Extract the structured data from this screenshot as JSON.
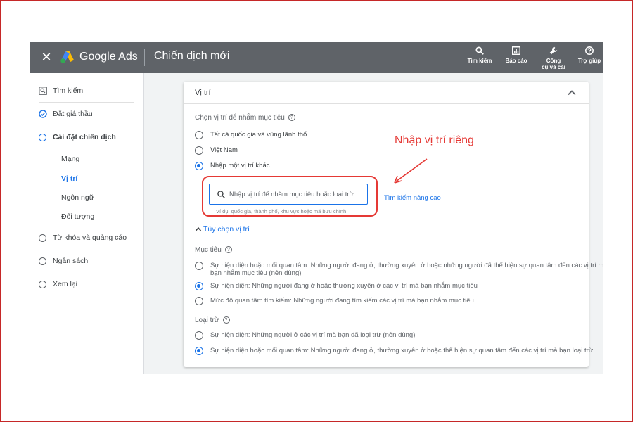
{
  "topbar": {
    "close_icon": "close-icon",
    "brand": "Google Ads",
    "page_title": "Chiến dịch mới",
    "tools": [
      {
        "label": "Tìm kiếm",
        "icon": "search-icon"
      },
      {
        "label": "Báo cáo",
        "icon": "report-icon"
      },
      {
        "label_line1": "Công",
        "label_line2": "cụ và cài",
        "icon": "wrench-icon"
      },
      {
        "label": "Trợ giúp",
        "icon": "help-icon"
      }
    ]
  },
  "sidebar": {
    "search": "Tìm kiếm",
    "bidding": "Đặt giá thầu",
    "campaign_settings": "Cài đặt chiến dịch",
    "sub": [
      "Mạng",
      "Vị trí",
      "Ngôn ngữ",
      "Đối tượng"
    ],
    "keywords_ads": "Từ khóa và quảng cáo",
    "budget": "Ngân sách",
    "review": "Xem lại"
  },
  "card": {
    "title": "Vị trí",
    "choose_label": "Chọn vị trí để nhắm mục tiêu",
    "options": [
      "Tất cả quốc gia và vùng lãnh thổ",
      "Việt Nam",
      "Nhập một vị trí khác"
    ],
    "selected_option": 2,
    "search_placeholder": "Nhập vị trí để nhắm mục tiêu hoặc loại trừ",
    "search_hint": "Ví dụ: quốc gia, thành phố, khu vực hoặc mã bưu chính",
    "advanced_link": "Tìm kiếm nâng cao",
    "options_toggle": "Tùy chọn vị trí",
    "target_label": "Mục tiêu",
    "target_options": [
      {
        "line1": "Sự hiện diện hoặc mối quan tâm: Những người đang ở, thường xuyên ở hoặc những người đã thể hiện sự quan tâm đến các vị trí mà",
        "line2": "bạn nhắm mục tiêu (nên dùng)"
      },
      {
        "line1": "Sự hiện diện: Những người đang ở hoặc thường xuyên ở các vị trí mà bạn nhắm mục tiêu"
      },
      {
        "line1": "Mức độ quan tâm tìm kiếm: Những người đang tìm kiếm các vị trí mà bạn nhắm mục tiêu"
      }
    ],
    "target_selected": 1,
    "exclude_label": "Loại trừ",
    "exclude_options": [
      "Sự hiện diện: Những người ở các vị trí mà bạn đã loại trừ (nên dùng)",
      "Sự hiện diện hoặc mối quan tâm: Những người đang ở, thường xuyên ở hoặc thể hiện sự quan tâm đến các vị trí mà bạn loại trừ"
    ],
    "exclude_selected": 1
  },
  "annotation": {
    "text": "Nhập vị trí riêng",
    "color": "#e53935"
  },
  "colors": {
    "topbar": "#5f6368",
    "accent": "#1a73e8",
    "highlight": "#e53935"
  }
}
